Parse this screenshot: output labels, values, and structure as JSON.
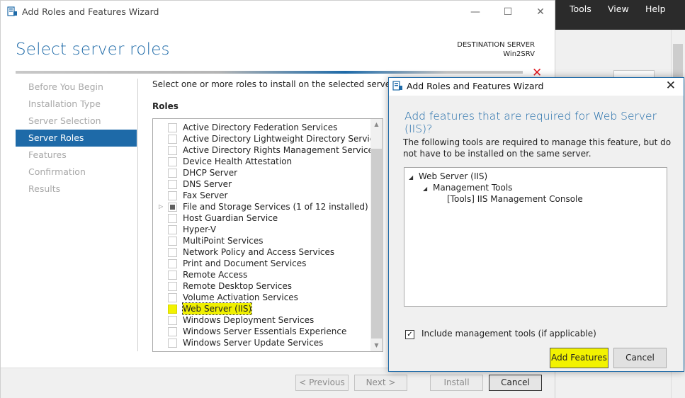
{
  "server_manager": {
    "menu": [
      "Tools",
      "View",
      "Help"
    ]
  },
  "wizard": {
    "title": "Add Roles and Features Wizard",
    "minimize": "—",
    "maximize": "☐",
    "close": "✕",
    "page_title": "Select server roles",
    "destination_label": "DESTINATION SERVER",
    "destination_value": "Win2SRV",
    "nav": [
      "Before You Begin",
      "Installation Type",
      "Server Selection",
      "Server Roles",
      "Features",
      "Confirmation",
      "Results"
    ],
    "nav_active_index": 3,
    "instruction": "Select one or more roles to install on the selected server.",
    "roles_label": "Roles",
    "roles": [
      "Active Directory Federation Services",
      "Active Directory Lightweight Directory Services",
      "Active Directory Rights Management Services",
      "Device Health Attestation",
      "DHCP Server",
      "DNS Server",
      "Fax Server",
      "File and Storage Services (1 of 12 installed)",
      "Host Guardian Service",
      "Hyper-V",
      "MultiPoint Services",
      "Network Policy and Access Services",
      "Print and Document Services",
      "Remote Access",
      "Remote Desktop Services",
      "Volume Activation Services",
      "Web Server (IIS)",
      "Windows Deployment Services",
      "Windows Server Essentials Experience",
      "Windows Server Update Services"
    ],
    "buttons": {
      "previous": "< Previous",
      "next": "Next >",
      "install": "Install",
      "cancel": "Cancel"
    }
  },
  "dialog": {
    "title": "Add Roles and Features Wizard",
    "close": "✕",
    "heading": "Add features that are required for Web Server (IIS)?",
    "text": "The following tools are required to manage this feature, but do not have to be installed on the same server.",
    "tree": [
      {
        "label": "Web Server (IIS)",
        "level": 0,
        "expander": "◢"
      },
      {
        "label": "Management Tools",
        "level": 1,
        "expander": "◢"
      },
      {
        "label": "[Tools] IIS Management Console",
        "level": 2,
        "expander": ""
      }
    ],
    "include_label": "Include management tools (if applicable)",
    "include_checked": "✓",
    "add_button": "Add Features",
    "cancel_button": "Cancel"
  },
  "colors": {
    "accent": "#1e6aa8",
    "highlight": "#f2f200"
  }
}
